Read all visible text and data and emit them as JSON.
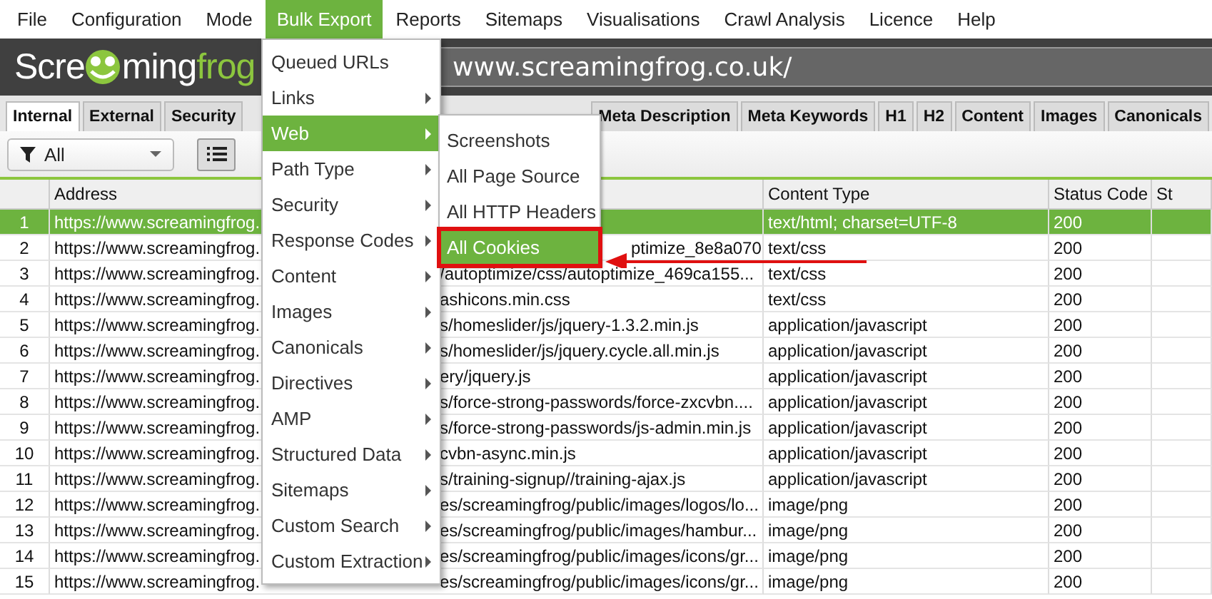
{
  "menu_bar": [
    {
      "label": "File",
      "selected": false
    },
    {
      "label": "Configuration",
      "selected": false
    },
    {
      "label": "Mode",
      "selected": false
    },
    {
      "label": "Bulk Export",
      "selected": true
    },
    {
      "label": "Reports",
      "selected": false
    },
    {
      "label": "Sitemaps",
      "selected": false
    },
    {
      "label": "Visualisations",
      "selected": false
    },
    {
      "label": "Crawl Analysis",
      "selected": false
    },
    {
      "label": "Licence",
      "selected": false
    },
    {
      "label": "Help",
      "selected": false
    }
  ],
  "logo": {
    "parts": [
      "Scre",
      "ming",
      "frog"
    ]
  },
  "url_field": {
    "value": "www.screamingfrog.co.uk/"
  },
  "tabs_left": [
    {
      "label": "Internal",
      "selected": true
    },
    {
      "label": "External",
      "selected": false
    },
    {
      "label": "Security",
      "selected": false
    }
  ],
  "tabs_right": [
    {
      "label": "Meta Description",
      "selected": false
    },
    {
      "label": "Meta Keywords",
      "selected": false
    },
    {
      "label": "H1",
      "selected": false
    },
    {
      "label": "H2",
      "selected": false
    },
    {
      "label": "Content",
      "selected": false
    },
    {
      "label": "Images",
      "selected": false
    },
    {
      "label": "Canonicals",
      "selected": false
    }
  ],
  "filter": {
    "value": "All"
  },
  "table": {
    "columns": [
      "Address",
      "Content Type",
      "Status Code",
      "St"
    ],
    "rows": [
      {
        "index": "1",
        "address_start": "https://www.screamingfrog.",
        "content_type": "text/html; charset=UTF-8",
        "status_code": "200",
        "selected": true
      },
      {
        "index": "2",
        "address_start": "https://www.screamingfrog.",
        "address_end": "ptimize_8e8a070",
        "content_type": "text/css",
        "status_code": "200",
        "selected": false
      },
      {
        "index": "3",
        "address_start": "https://www.screamingfrog.",
        "address_end": "/autoptimize/css/autoptimize_469ca155...",
        "content_type": "text/css",
        "status_code": "200",
        "selected": false
      },
      {
        "index": "4",
        "address_start": "https://www.screamingfrog.",
        "address_end": "ashicons.min.css",
        "content_type": "text/css",
        "status_code": "200",
        "selected": false
      },
      {
        "index": "5",
        "address_start": "https://www.screamingfrog.",
        "address_end": "s/homeslider/js/jquery-1.3.2.min.js",
        "content_type": "application/javascript",
        "status_code": "200",
        "selected": false
      },
      {
        "index": "6",
        "address_start": "https://www.screamingfrog.",
        "address_end": "s/homeslider/js/jquery.cycle.all.min.js",
        "content_type": "application/javascript",
        "status_code": "200",
        "selected": false
      },
      {
        "index": "7",
        "address_start": "https://www.screamingfrog.",
        "address_end": "ery/jquery.js",
        "content_type": "application/javascript",
        "status_code": "200",
        "selected": false
      },
      {
        "index": "8",
        "address_start": "https://www.screamingfrog.",
        "address_end": "s/force-strong-passwords/force-zxcvbn....",
        "content_type": "application/javascript",
        "status_code": "200",
        "selected": false
      },
      {
        "index": "9",
        "address_start": "https://www.screamingfrog.",
        "address_end": "s/force-strong-passwords/js-admin.min.js",
        "content_type": "application/javascript",
        "status_code": "200",
        "selected": false
      },
      {
        "index": "10",
        "address_start": "https://www.screamingfrog.",
        "address_end": "cvbn-async.min.js",
        "content_type": "application/javascript",
        "status_code": "200",
        "selected": false
      },
      {
        "index": "11",
        "address_start": "https://www.screamingfrog.",
        "address_end": "s/training-signup//training-ajax.js",
        "content_type": "application/javascript",
        "status_code": "200",
        "selected": false
      },
      {
        "index": "12",
        "address_start": "https://www.screamingfrog.",
        "address_end": "es/screamingfrog/public/images/logos/lo...",
        "content_type": "image/png",
        "status_code": "200",
        "selected": false
      },
      {
        "index": "13",
        "address_start": "https://www.screamingfrog.",
        "address_end": "es/screamingfrog/public/images/hambur...",
        "content_type": "image/png",
        "status_code": "200",
        "selected": false
      },
      {
        "index": "14",
        "address_start": "https://www.screamingfrog.",
        "address_end": "es/screamingfrog/public/images/icons/gr...",
        "content_type": "image/png",
        "status_code": "200",
        "selected": false
      },
      {
        "index": "15",
        "address_start": "https://www.screamingfrog.",
        "address_end": "es/screamingfrog/public/images/icons/gr...",
        "content_type": "image/png",
        "status_code": "200",
        "selected": false
      }
    ]
  },
  "dropdown_menu": {
    "items": [
      {
        "label": "Queued URLs",
        "has_submenu": false,
        "selected": false
      },
      {
        "label": "Links",
        "has_submenu": true,
        "selected": false
      },
      {
        "label": "Web",
        "has_submenu": true,
        "selected": true
      },
      {
        "label": "Path Type",
        "has_submenu": true,
        "selected": false
      },
      {
        "label": "Security",
        "has_submenu": true,
        "selected": false
      },
      {
        "label": "Response Codes",
        "has_submenu": true,
        "selected": false
      },
      {
        "label": "Content",
        "has_submenu": true,
        "selected": false
      },
      {
        "label": "Images",
        "has_submenu": true,
        "selected": false
      },
      {
        "label": "Canonicals",
        "has_submenu": true,
        "selected": false
      },
      {
        "label": "Directives",
        "has_submenu": true,
        "selected": false
      },
      {
        "label": "AMP",
        "has_submenu": true,
        "selected": false
      },
      {
        "label": "Structured Data",
        "has_submenu": true,
        "selected": false
      },
      {
        "label": "Sitemaps",
        "has_submenu": true,
        "selected": false
      },
      {
        "label": "Custom Search",
        "has_submenu": true,
        "selected": false
      },
      {
        "label": "Custom Extraction",
        "has_submenu": true,
        "selected": false
      }
    ]
  },
  "submenu": {
    "items": [
      {
        "label": "Screenshots",
        "selected": false,
        "callout": false
      },
      {
        "label": "All Page Source",
        "selected": false,
        "callout": false
      },
      {
        "label": "All HTTP Headers",
        "selected": false,
        "callout": false
      },
      {
        "label": "All Cookies",
        "selected": true,
        "callout": true
      }
    ]
  }
}
